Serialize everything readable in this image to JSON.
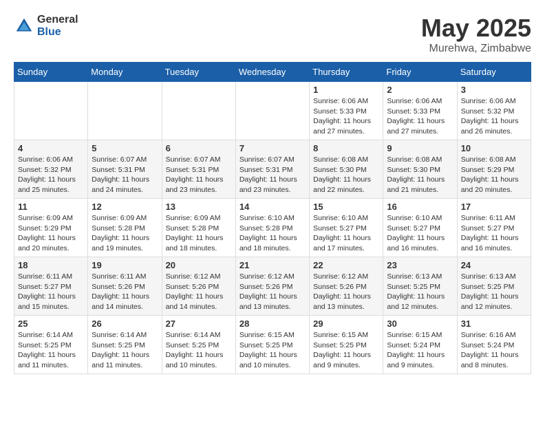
{
  "logo": {
    "general": "General",
    "blue": "Blue"
  },
  "title": "May 2025",
  "location": "Murehwa, Zimbabwe",
  "days_of_week": [
    "Sunday",
    "Monday",
    "Tuesday",
    "Wednesday",
    "Thursday",
    "Friday",
    "Saturday"
  ],
  "weeks": [
    [
      {
        "day": "",
        "content": ""
      },
      {
        "day": "",
        "content": ""
      },
      {
        "day": "",
        "content": ""
      },
      {
        "day": "",
        "content": ""
      },
      {
        "day": "1",
        "content": "Sunrise: 6:06 AM\nSunset: 5:33 PM\nDaylight: 11 hours and 27 minutes."
      },
      {
        "day": "2",
        "content": "Sunrise: 6:06 AM\nSunset: 5:33 PM\nDaylight: 11 hours and 27 minutes."
      },
      {
        "day": "3",
        "content": "Sunrise: 6:06 AM\nSunset: 5:32 PM\nDaylight: 11 hours and 26 minutes."
      }
    ],
    [
      {
        "day": "4",
        "content": "Sunrise: 6:06 AM\nSunset: 5:32 PM\nDaylight: 11 hours and 25 minutes."
      },
      {
        "day": "5",
        "content": "Sunrise: 6:07 AM\nSunset: 5:31 PM\nDaylight: 11 hours and 24 minutes."
      },
      {
        "day": "6",
        "content": "Sunrise: 6:07 AM\nSunset: 5:31 PM\nDaylight: 11 hours and 23 minutes."
      },
      {
        "day": "7",
        "content": "Sunrise: 6:07 AM\nSunset: 5:31 PM\nDaylight: 11 hours and 23 minutes."
      },
      {
        "day": "8",
        "content": "Sunrise: 6:08 AM\nSunset: 5:30 PM\nDaylight: 11 hours and 22 minutes."
      },
      {
        "day": "9",
        "content": "Sunrise: 6:08 AM\nSunset: 5:30 PM\nDaylight: 11 hours and 21 minutes."
      },
      {
        "day": "10",
        "content": "Sunrise: 6:08 AM\nSunset: 5:29 PM\nDaylight: 11 hours and 20 minutes."
      }
    ],
    [
      {
        "day": "11",
        "content": "Sunrise: 6:09 AM\nSunset: 5:29 PM\nDaylight: 11 hours and 20 minutes."
      },
      {
        "day": "12",
        "content": "Sunrise: 6:09 AM\nSunset: 5:28 PM\nDaylight: 11 hours and 19 minutes."
      },
      {
        "day": "13",
        "content": "Sunrise: 6:09 AM\nSunset: 5:28 PM\nDaylight: 11 hours and 18 minutes."
      },
      {
        "day": "14",
        "content": "Sunrise: 6:10 AM\nSunset: 5:28 PM\nDaylight: 11 hours and 18 minutes."
      },
      {
        "day": "15",
        "content": "Sunrise: 6:10 AM\nSunset: 5:27 PM\nDaylight: 11 hours and 17 minutes."
      },
      {
        "day": "16",
        "content": "Sunrise: 6:10 AM\nSunset: 5:27 PM\nDaylight: 11 hours and 16 minutes."
      },
      {
        "day": "17",
        "content": "Sunrise: 6:11 AM\nSunset: 5:27 PM\nDaylight: 11 hours and 16 minutes."
      }
    ],
    [
      {
        "day": "18",
        "content": "Sunrise: 6:11 AM\nSunset: 5:27 PM\nDaylight: 11 hours and 15 minutes."
      },
      {
        "day": "19",
        "content": "Sunrise: 6:11 AM\nSunset: 5:26 PM\nDaylight: 11 hours and 14 minutes."
      },
      {
        "day": "20",
        "content": "Sunrise: 6:12 AM\nSunset: 5:26 PM\nDaylight: 11 hours and 14 minutes."
      },
      {
        "day": "21",
        "content": "Sunrise: 6:12 AM\nSunset: 5:26 PM\nDaylight: 11 hours and 13 minutes."
      },
      {
        "day": "22",
        "content": "Sunrise: 6:12 AM\nSunset: 5:26 PM\nDaylight: 11 hours and 13 minutes."
      },
      {
        "day": "23",
        "content": "Sunrise: 6:13 AM\nSunset: 5:25 PM\nDaylight: 11 hours and 12 minutes."
      },
      {
        "day": "24",
        "content": "Sunrise: 6:13 AM\nSunset: 5:25 PM\nDaylight: 11 hours and 12 minutes."
      }
    ],
    [
      {
        "day": "25",
        "content": "Sunrise: 6:14 AM\nSunset: 5:25 PM\nDaylight: 11 hours and 11 minutes."
      },
      {
        "day": "26",
        "content": "Sunrise: 6:14 AM\nSunset: 5:25 PM\nDaylight: 11 hours and 11 minutes."
      },
      {
        "day": "27",
        "content": "Sunrise: 6:14 AM\nSunset: 5:25 PM\nDaylight: 11 hours and 10 minutes."
      },
      {
        "day": "28",
        "content": "Sunrise: 6:15 AM\nSunset: 5:25 PM\nDaylight: 11 hours and 10 minutes."
      },
      {
        "day": "29",
        "content": "Sunrise: 6:15 AM\nSunset: 5:25 PM\nDaylight: 11 hours and 9 minutes."
      },
      {
        "day": "30",
        "content": "Sunrise: 6:15 AM\nSunset: 5:24 PM\nDaylight: 11 hours and 9 minutes."
      },
      {
        "day": "31",
        "content": "Sunrise: 6:16 AM\nSunset: 5:24 PM\nDaylight: 11 hours and 8 minutes."
      }
    ]
  ]
}
